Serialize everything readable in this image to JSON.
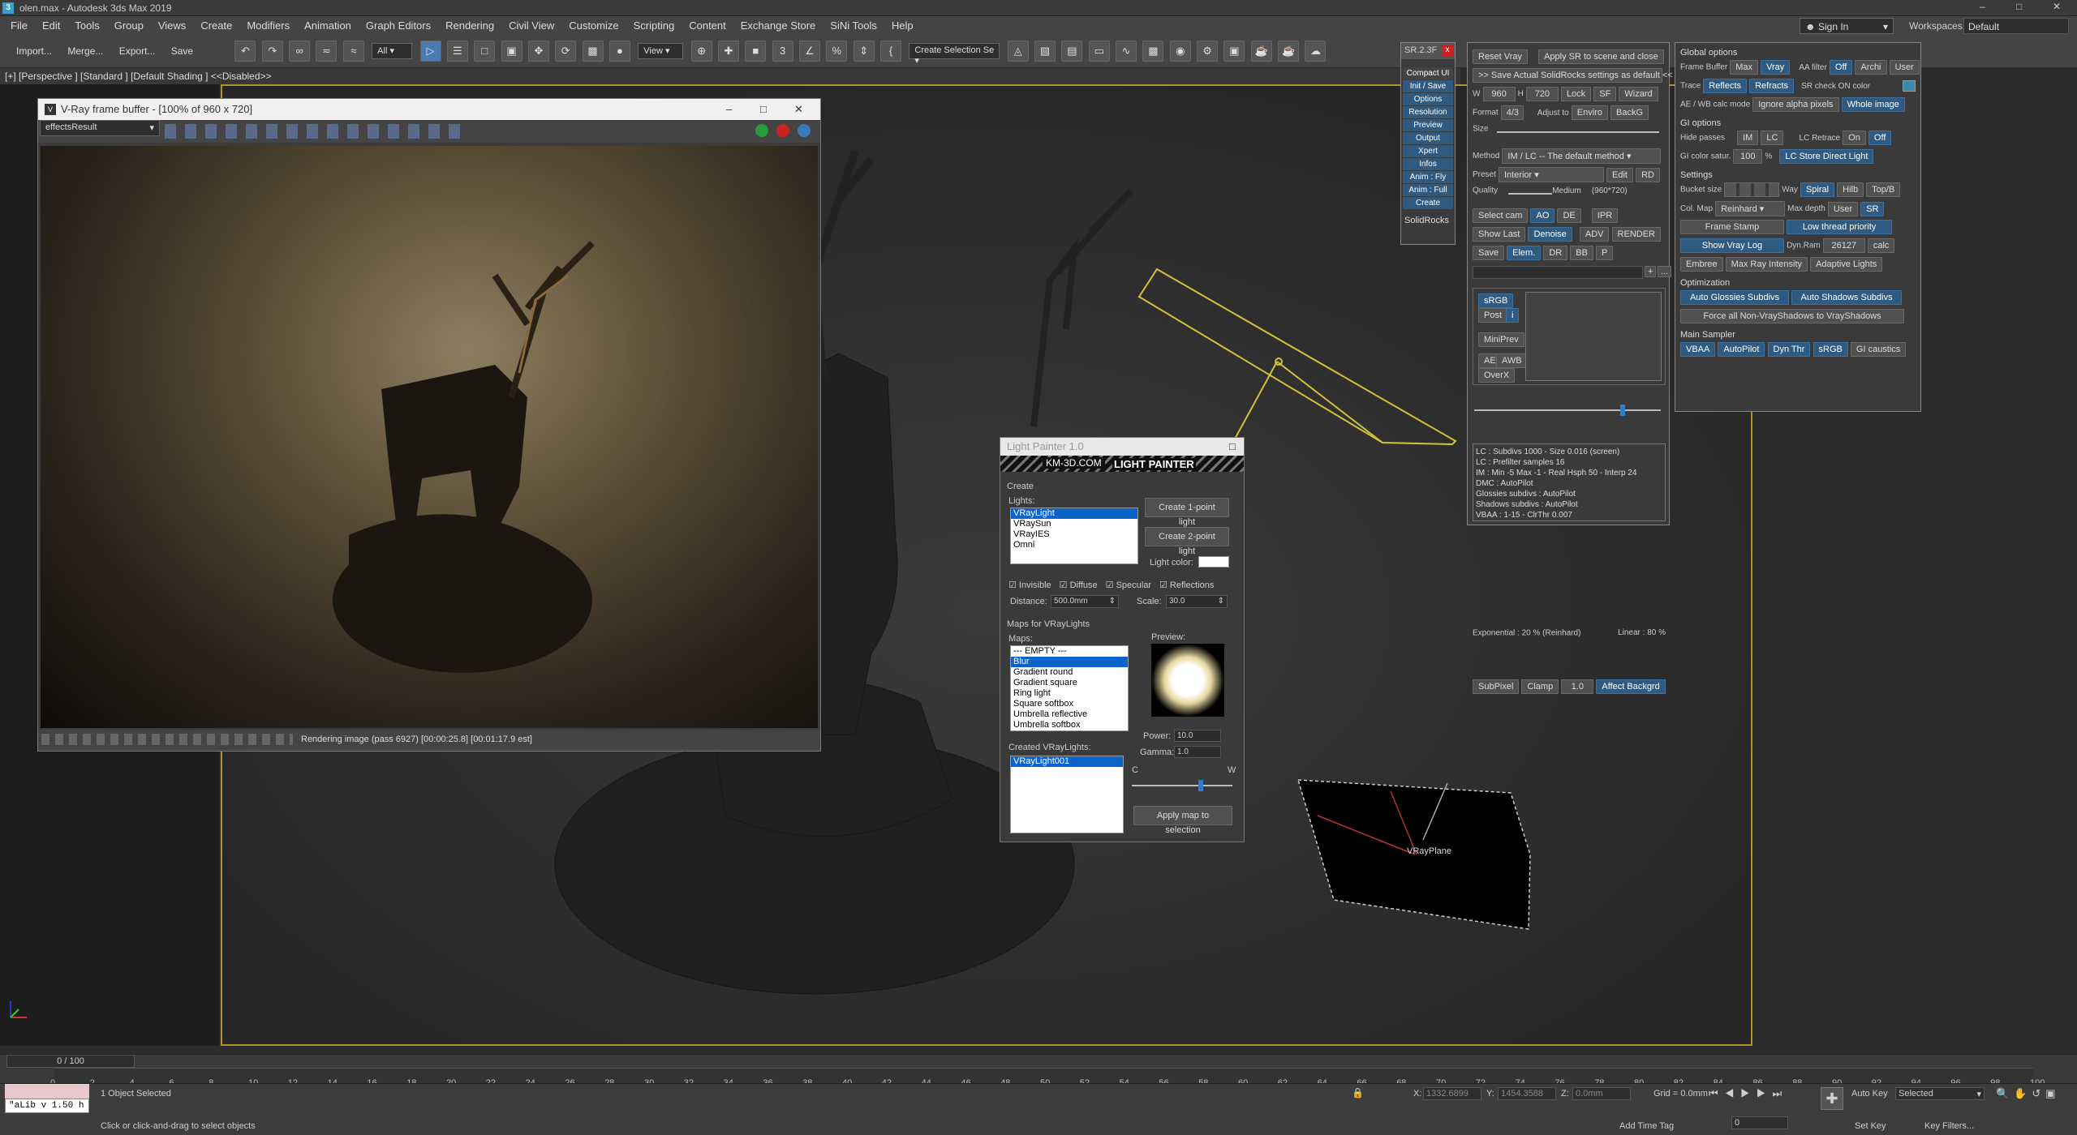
{
  "app": {
    "file": "olen.max",
    "title": "olen.max - Autodesk 3ds Max 2019"
  },
  "menu": [
    "File",
    "Edit",
    "Tools",
    "Group",
    "Views",
    "Create",
    "Modifiers",
    "Animation",
    "Graph Editors",
    "Rendering",
    "Civil View",
    "Customize",
    "Scripting",
    "Content",
    "Exchange Store",
    "SiNi Tools",
    "Help"
  ],
  "account": {
    "signin": "Sign In",
    "workspaces_label": "Workspaces:",
    "workspace": "Default"
  },
  "toolbar": {
    "import": "Import...",
    "merge": "Merge...",
    "export": "Export...",
    "save": "Save",
    "filter": "All",
    "refcoord": "View",
    "selset": "Create Selection Se"
  },
  "viewport": {
    "label": "[+] [Perspective ] [Standard ] [Default Shading ]  <<Disabled>>",
    "plane_label": "VRayPlane"
  },
  "vfb": {
    "title": "V-Ray frame buffer - [100% of 960 x 720]",
    "channel": "effectsResult",
    "status": "Rendering image (pass 6927) [00:00:25.8] [00:01:17.9 est]"
  },
  "lightpainter": {
    "title": "Light Painter 1.0",
    "banner_left": "KM-3D.COM",
    "banner_right": "LIGHT PAINTER",
    "create": "Create",
    "lights_label": "Lights:",
    "lights": [
      "VRayLight",
      "VRaySun",
      "VRayIES",
      "Omni"
    ],
    "btn_1pt": "Create 1-point light",
    "btn_2pt": "Create 2-point light",
    "light_color": "Light color:",
    "checks": [
      "Invisible",
      "Diffuse",
      "Specular",
      "Reflections"
    ],
    "distance_label": "Distance:",
    "distance": "500.0mm",
    "scale_label": "Scale:",
    "scale": "30.0",
    "maps_for": "Maps for VRayLights",
    "maps_label": "Maps:",
    "preview_label": "Preview:",
    "maps": [
      "--- EMPTY ---",
      "Blur",
      "Gradient round",
      "Gradient square",
      "Ring light",
      "Square softbox",
      "Umbrella reflective",
      "Umbrella softbox"
    ],
    "power_label": "Power:",
    "power": "10.0",
    "gamma_label": "Gamma:",
    "gamma": "1.0",
    "created_label": "Created VRayLights:",
    "created": [
      "VRayLight001"
    ],
    "cw_c": "C",
    "cw_w": "W",
    "apply": "Apply map to selection"
  },
  "solidrocks": {
    "tab": "SR.2.3F",
    "side": [
      "Compact UI",
      "Init / Save",
      "Options",
      "Resolution",
      "Preview",
      "Output",
      "Xpert",
      "Infos",
      "Anim : Fly",
      "Anim : Full",
      "Create"
    ],
    "logo": "SolidRocks",
    "reset": "Reset Vray",
    "apply_sr": "Apply SR to scene and close",
    "save_default": ">> Save Actual SolidRocks settings as default <<",
    "w_label": "W",
    "w": "960",
    "h_label": "H",
    "h": "720",
    "lock": "Lock",
    "sf": "SF",
    "wizard": "Wizard",
    "format_label": "Format",
    "ratio": "4/3",
    "adjust": "Adjust to",
    "enviro": "Enviro",
    "backg": "BackG",
    "size_label": "Size",
    "method_label": "Method",
    "method": "IM / LC -- The default method",
    "preset_label": "Preset",
    "preset": "Interior",
    "edit": "Edit",
    "rd": "RD",
    "quality_label": "Quality",
    "quality": "Medium",
    "quality_res": "(960*720)",
    "selcam": "Select cam",
    "ao": "AO",
    "de": "DE",
    "ipr": "IPR",
    "showlast": "Show Last",
    "denoise": "Denoise",
    "adv": "ADV",
    "render": "RENDER",
    "save": "Save",
    "elem": "Elem.",
    "dr": "DR",
    "bb": "BB",
    "p": "P",
    "plus": "+",
    "dots": "...",
    "srgb": "sRGB",
    "post": "Post",
    "i": "i",
    "miniprev": "MiniPrev",
    "ae": "AE",
    "awb": "AWB",
    "overx": "OverX",
    "exponential": "Exponential : 20 % (Reinhard)",
    "linear": "Linear : 80 %",
    "subpixel": "SubPixel",
    "clamp": "Clamp",
    "clamp_val": "1.0",
    "affect": "Affect Backgrd",
    "info": [
      "LC : Subdivs 1000 - Size 0.016 (screen)",
      "LC : Prefilter samples 16",
      "IM : Min -5 Max -1 - Real Hsph 50 - Interp 24",
      "DMC : AutoPilot",
      "Glossies subdivs : AutoPilot",
      "Shadows subdivs : AutoPilot",
      "VBAA  : 1-15 - ClrThr 0.007"
    ]
  },
  "global": {
    "title": "Global options",
    "fb_label": "Frame Buffer",
    "max": "Max",
    "vray": "Vray",
    "aa_label": "AA filter",
    "off": "Off",
    "archi": "Archi",
    "user": "User",
    "trace": "Trace",
    "reflects": "Reflects",
    "refracts": "Refracts",
    "srcheck": "SR check ON color",
    "aewb": "AE / WB calc mode",
    "ignore_alpha": "Ignore alpha pixels",
    "whole": "Whole image",
    "gi_title": "GI options",
    "hide_passes": "Hide passes",
    "im": "IM",
    "lc": "LC",
    "lc_retrace": "LC Retrace",
    "on": "On",
    "off2": "Off",
    "gi_satur": "GI color satur.",
    "gi_val": "100",
    "pct": "%",
    "lc_store": "LC Store Direct Light",
    "settings": "Settings",
    "bucket": "Bucket size",
    "way": "Way",
    "spiral": "Spiral",
    "hilb": "Hilb",
    "topb": "Top/B",
    "colmap": "Col. Map",
    "reinhard": "Reinhard",
    "maxdepth": "Max depth",
    "user2": "User",
    "sr": "SR",
    "framestamp": "Frame Stamp",
    "lowthread": "Low thread priority",
    "showvraylog": "Show Vray Log",
    "dynram": "Dyn.Ram",
    "dynval": "26127",
    "calc": "calc",
    "embree": "Embree",
    "maxray": "Max Ray Intensity",
    "adaptive": "Adaptive Lights",
    "opt": "Optimization",
    "autogloss": "Auto Glossies Subdivs",
    "autoshadow": "Auto Shadows Subdivs",
    "forceall": "Force all Non-VrayShadows to VrayShadows",
    "mainsampler": "Main Sampler",
    "vbaa": "VBAA",
    "autopilot": "AutoPilot",
    "dynthr": "Dyn Thr",
    "srgb2": "sRGB",
    "gicaustics": "GI caustics"
  },
  "timeline": {
    "frame": "0 / 100",
    "ticks": [
      "0",
      "2",
      "4",
      "6",
      "8",
      "10",
      "12",
      "14",
      "16",
      "18",
      "20",
      "22",
      "24",
      "26",
      "28",
      "30",
      "32",
      "34",
      "36",
      "38",
      "40",
      "42",
      "44",
      "46",
      "48",
      "50",
      "52",
      "54",
      "56",
      "58",
      "60",
      "62",
      "64",
      "66",
      "68",
      "70",
      "72",
      "74",
      "76",
      "78",
      "80",
      "82",
      "84",
      "86",
      "88",
      "90",
      "92",
      "94",
      "96",
      "98",
      "100"
    ]
  },
  "status": {
    "maxscript": "\"aLib v 1.50 h",
    "selected": "1 Object Selected",
    "hint": "Click or click-and-drag to select objects",
    "x_label": "X:",
    "x": "1332.6899",
    "y_label": "Y:",
    "y": "1454.3588",
    "z_label": "Z:",
    "z": "0.0mm",
    "grid": "Grid = 0.0mm",
    "addtime": "Add Time Tag",
    "autokey": "Auto Key",
    "selected_dd": "Selected",
    "setkey": "Set Key",
    "keyfilters": "Key Filters...",
    "frame_field": "0"
  },
  "colors": {
    "accent": "#2f5a82",
    "frame_yellow": "#b0902a",
    "light_yellow": "#d2c23a"
  }
}
